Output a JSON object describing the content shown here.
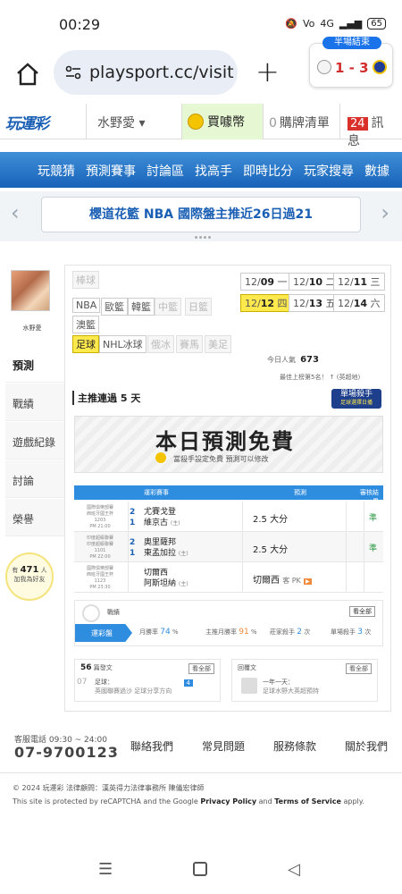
{
  "status": {
    "time": "00:29",
    "network": "4G",
    "signal": "Vo",
    "battery": "65"
  },
  "browser": {
    "url": "playsport.cc/visit"
  },
  "score_widget": {
    "status": "半場結束",
    "score": "1 - 3"
  },
  "header": {
    "logo": "玩運彩",
    "user": "水野愛",
    "coins_label": "買噱幣",
    "cart_count": "0",
    "cart_label": "購牌清單",
    "msg_count": "24",
    "msg_label": "訊息"
  },
  "nav": {
    "items": [
      "玩競猜",
      "預測賽事",
      "討論區",
      "找高手",
      "即時比分",
      "玩家搜尋",
      "數據"
    ]
  },
  "banner": {
    "text": "櫻道花籃 NBA 國際盤主推近26日過21"
  },
  "side": {
    "username": "水野愛",
    "tabs": [
      "預測",
      "戰績",
      "遊戲紀錄",
      "討論",
      "榮譽"
    ],
    "bulb_pre": "有",
    "bulb_num": "471",
    "bulb_post": "人",
    "bulb_line2": "加我為好友"
  },
  "leagues": [
    {
      "label": "棒球",
      "state": "dis"
    },
    {
      "label": "NBA",
      "state": ""
    },
    {
      "label": "歐籃",
      "state": ""
    },
    {
      "label": "韓籃",
      "state": ""
    },
    {
      "label": "中籃",
      "state": "dis"
    },
    {
      "label": "日籃",
      "state": "dis"
    },
    {
      "label": "澳籃",
      "state": ""
    },
    {
      "label": "足球",
      "state": "sel"
    },
    {
      "label": "NHL冰球",
      "state": ""
    },
    {
      "label": "俄冰",
      "state": "dis"
    },
    {
      "label": "賽馬",
      "state": "dis"
    },
    {
      "label": "美足",
      "state": "dis"
    }
  ],
  "dates": [
    {
      "md": "12/",
      "d": "09",
      "w": "一",
      "state": ""
    },
    {
      "md": "12/",
      "d": "10",
      "w": "二",
      "state": ""
    },
    {
      "md": "12/",
      "d": "11",
      "w": "三",
      "state": ""
    },
    {
      "md": "12/",
      "d": "12",
      "w": "四",
      "state": "sel"
    },
    {
      "md": "12/",
      "d": "13",
      "w": "五",
      "state": ""
    },
    {
      "md": "12/",
      "d": "14",
      "w": "六",
      "state": ""
    }
  ],
  "stats": {
    "today_label": "今日人氣",
    "today_value": "673",
    "rank_text": "最佳上榜第5名！ ↑ (英超地)"
  },
  "streak": "主推連過 5 天",
  "champion": {
    "line1": "單場殺手",
    "line2": "足球選擇日播"
  },
  "free": {
    "title": "本日預測免費",
    "subtitle": "當殺手設定免費 預測可以修改"
  },
  "table": {
    "headers": [
      "運彩賽事",
      "預測",
      "審核",
      "結果"
    ],
    "rows": [
      {
        "info": [
          "國際俱樂部賽",
          "西班牙國王杯",
          "1203",
          "PM 21:00"
        ],
        "n1": "2",
        "n2": "1",
        "t1": "尤賽戈登",
        "t2": "維京古",
        "t2tag": "(主)",
        "pick": "2.5 大分",
        "pk": "",
        "result": "準"
      },
      {
        "info": [
          "印度超級聯賽",
          "印度超級聯賽",
          "1101",
          "PM 22:00"
        ],
        "n1": "2",
        "n2": "1",
        "t1": "奧里薩邦",
        "t2": "東孟加拉",
        "t2tag": "(主)",
        "pick": "2.5 大分",
        "pk": "",
        "result": "準"
      },
      {
        "info": [
          "國際俱樂部賽",
          "西班牙國王杯",
          "1123",
          "PM 23:30"
        ],
        "n1": "",
        "n2": "",
        "t1": "切爾西",
        "t2": "阿斯坦納",
        "t2tag": "(主)",
        "pick": "切爾西",
        "pk": "客 PK",
        "result": ""
      }
    ]
  },
  "rates": {
    "title": "戰績",
    "more": "看全部",
    "tab": "運彩盤",
    "month_label": "月勝率",
    "month_value": "74",
    "pct": "%",
    "main_label": "主推月勝率",
    "main_value": "91",
    "killer_label": "莊家殺手",
    "killer_value": "2",
    "killer_unit": "次",
    "single_label": "單場殺手",
    "single_value": "3",
    "single_unit": "次"
  },
  "minis": [
    {
      "head_num": "56",
      "head_label": "篇發文",
      "more": "看全部",
      "num": "07",
      "l1": "足球：",
      "l2": "英國聯賽過沙 足球分享方向",
      "tag": "4"
    },
    {
      "head_num": "",
      "head_label": "回覆文",
      "more": "看全部",
      "num": "",
      "l1": "一年一天：",
      "l2": "足球水野大英超預持",
      "tag": ""
    }
  ],
  "footer": {
    "hotline_label": "客服電話 09:30 ~ 24:00",
    "hotline": "07-9700123",
    "links": [
      "聯絡我們",
      "常見問題",
      "服務條款",
      "關於我們"
    ],
    "copyright": "© 2024 玩運彩 法律顧問：漢英得力法律事務所 陳儀宏律師",
    "recaptcha_pre": "This site is protected by reCAPTCHA and the Google",
    "privacy": "Privacy Policy",
    "and": "and",
    "terms": "Terms of Service",
    "apply": "apply."
  },
  "colors": {
    "brand_blue": "#1862b8",
    "accent_yellow": "#ffe94d",
    "win_green": "#2e9a44",
    "danger_red": "#d32f2f"
  }
}
